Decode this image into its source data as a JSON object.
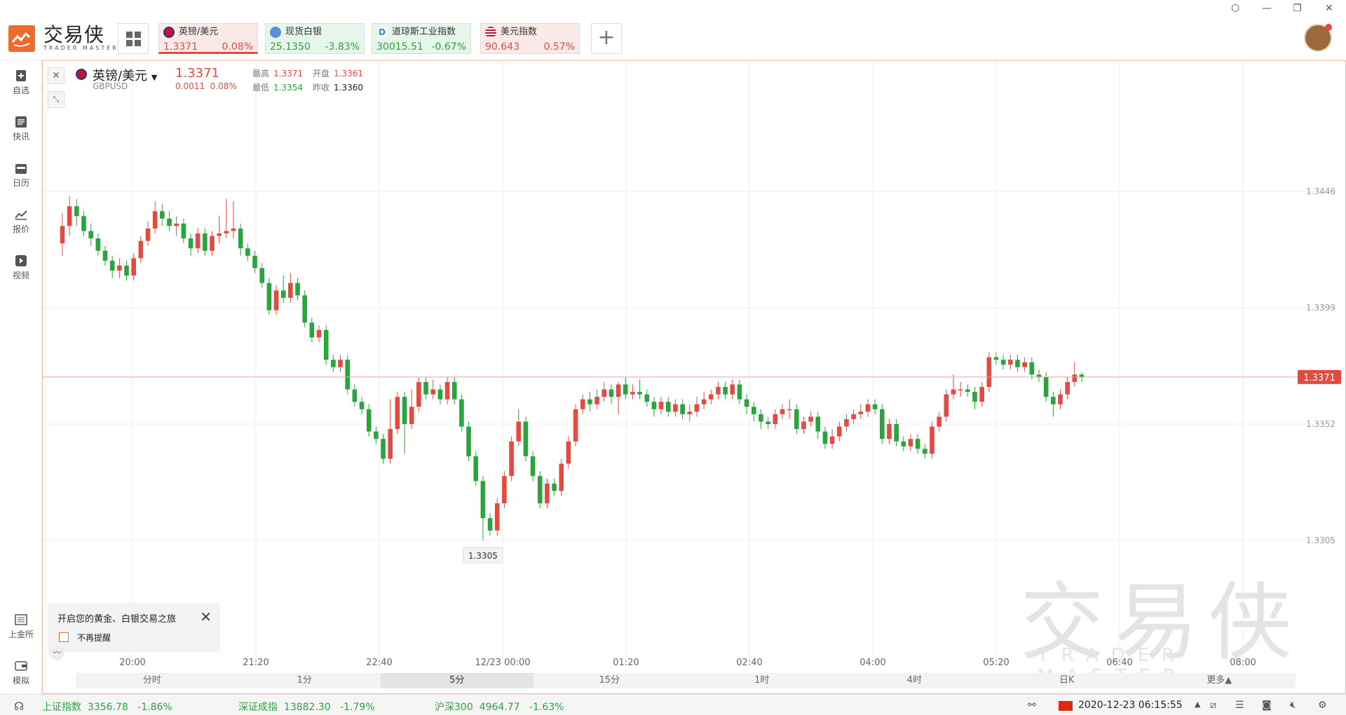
{
  "app": {
    "brand_cn": "交易侠",
    "brand_en": "TRADER MASTER"
  },
  "quote_tabs": [
    {
      "name": "英镑/美元",
      "price": "1.3371",
      "change": "0.08%",
      "direction": "up"
    },
    {
      "name": "现货白银",
      "price": "25.1350",
      "change": "-3.83%",
      "direction": "down"
    },
    {
      "name": "道琼斯工业指数",
      "price": "30015.51",
      "change": "-0.67%",
      "direction": "down"
    },
    {
      "name": "美元指数",
      "price": "90.643",
      "change": "0.57%",
      "direction": "up"
    }
  ],
  "sidebar": [
    {
      "label": "自选",
      "icon": "plus-bookmark-icon"
    },
    {
      "label": "快讯",
      "icon": "news-icon"
    },
    {
      "label": "日历",
      "icon": "calendar-icon"
    },
    {
      "label": "报价",
      "icon": "trend-icon"
    },
    {
      "label": "视频",
      "icon": "play-icon"
    },
    {
      "label": "上金所",
      "icon": "exchange-icon"
    },
    {
      "label": "模拟",
      "icon": "wallet-icon"
    }
  ],
  "symbol": {
    "name": "英镑/美元",
    "code": "GBPUSD",
    "price": "1.3371",
    "change_abs": "0.0011",
    "change_pct": "0.08%",
    "high_label": "最高",
    "high": "1.3371",
    "open_label": "开盘",
    "open": "1.3361",
    "low_label": "最低",
    "low": "1.3354",
    "prev_label": "昨收",
    "prev": "1.3360"
  },
  "popup": {
    "title": "开启您的黄金、白银交易之旅",
    "checkbox_label": "不再提醒"
  },
  "timeframes": [
    "分时",
    "1分",
    "5分",
    "15分",
    "1时",
    "4时",
    "日K",
    "更多▲"
  ],
  "active_timeframe": "5分",
  "status": {
    "idx1_name": "上证指数",
    "idx1_val": "3356.78",
    "idx1_chg": "-1.86%",
    "idx2_name": "深证成指",
    "idx2_val": "13882.30",
    "idx2_chg": "-1.79%",
    "idx3_name": "沪深300",
    "idx3_val": "4964.77",
    "idx3_chg": "-1.63%",
    "datetime": "2020-12-23 06:15:55"
  },
  "chart_data": {
    "type": "candlestick",
    "y_ticks": [
      "1.3446",
      "1.3399",
      "1.3352",
      "1.3305"
    ],
    "ylim": [
      1.3258,
      1.3493
    ],
    "x_ticks": [
      "20:00",
      "21:20",
      "22:40",
      "12/23 00:00",
      "01:20",
      "02:40",
      "04:00",
      "05:20",
      "06:40",
      "08:00"
    ],
    "current_price": "1.3371",
    "min_label": "1.3305",
    "colors": {
      "up": "#e24b3f",
      "down": "#2aa43c",
      "grid": "#ececec",
      "axis_text": "#999999"
    },
    "candles": [
      [
        1.3425,
        1.3432,
        1.342,
        1.3437
      ],
      [
        1.3432,
        1.344,
        1.3428,
        1.3444
      ],
      [
        1.344,
        1.3436,
        1.3432,
        1.3443
      ],
      [
        1.3436,
        1.343,
        1.3428,
        1.3438
      ],
      [
        1.343,
        1.3427,
        1.3424,
        1.3433
      ],
      [
        1.3427,
        1.3422,
        1.342,
        1.3429
      ],
      [
        1.3422,
        1.3418,
        1.3416,
        1.3424
      ],
      [
        1.3418,
        1.3414,
        1.3411,
        1.342
      ],
      [
        1.3414,
        1.3416,
        1.3411,
        1.3419
      ],
      [
        1.3416,
        1.3412,
        1.341,
        1.3418
      ],
      [
        1.3412,
        1.3419,
        1.341,
        1.3421
      ],
      [
        1.3419,
        1.3426,
        1.3417,
        1.3428
      ],
      [
        1.3426,
        1.3431,
        1.3424,
        1.3434
      ],
      [
        1.3431,
        1.3438,
        1.3429,
        1.3442
      ],
      [
        1.3438,
        1.3435,
        1.3432,
        1.3441
      ],
      [
        1.3435,
        1.3432,
        1.343,
        1.3438
      ],
      [
        1.3432,
        1.3433,
        1.3428,
        1.3436
      ],
      [
        1.3433,
        1.3427,
        1.3425,
        1.3435
      ],
      [
        1.3427,
        1.3423,
        1.342,
        1.3429
      ],
      [
        1.3423,
        1.3429,
        1.3421,
        1.3431
      ],
      [
        1.3429,
        1.3422,
        1.342,
        1.3431
      ],
      [
        1.3422,
        1.3428,
        1.342,
        1.343
      ],
      [
        1.3428,
        1.3429,
        1.3425,
        1.3436
      ],
      [
        1.3429,
        1.343,
        1.3427,
        1.3443
      ],
      [
        1.343,
        1.3431,
        1.3427,
        1.3442
      ],
      [
        1.3431,
        1.3423,
        1.342,
        1.3433
      ],
      [
        1.3423,
        1.342,
        1.3418,
        1.3425
      ],
      [
        1.342,
        1.3415,
        1.3413,
        1.3422
      ],
      [
        1.3415,
        1.3409,
        1.3407,
        1.3417
      ],
      [
        1.3409,
        1.3398,
        1.3396,
        1.3411
      ],
      [
        1.3398,
        1.3406,
        1.3396,
        1.3408
      ],
      [
        1.3406,
        1.3403,
        1.3401,
        1.3412
      ],
      [
        1.3403,
        1.3409,
        1.3401,
        1.3413
      ],
      [
        1.3409,
        1.3404,
        1.3402,
        1.3411
      ],
      [
        1.3404,
        1.3393,
        1.3391,
        1.3406
      ],
      [
        1.3393,
        1.3387,
        1.3385,
        1.3395
      ],
      [
        1.3387,
        1.339,
        1.3385,
        1.3392
      ],
      [
        1.339,
        1.3378,
        1.3376,
        1.3392
      ],
      [
        1.3378,
        1.3375,
        1.3373,
        1.338
      ],
      [
        1.3375,
        1.3378,
        1.3373,
        1.338
      ],
      [
        1.3378,
        1.3366,
        1.3364,
        1.338
      ],
      [
        1.3366,
        1.3361,
        1.3359,
        1.3368
      ],
      [
        1.3361,
        1.3358,
        1.3356,
        1.3363
      ],
      [
        1.3358,
        1.3349,
        1.3347,
        1.336
      ],
      [
        1.3349,
        1.3346,
        1.3344,
        1.3351
      ],
      [
        1.3346,
        1.3338,
        1.3336,
        1.3348
      ],
      [
        1.3338,
        1.335,
        1.3336,
        1.3362
      ],
      [
        1.335,
        1.3363,
        1.3348,
        1.3365
      ],
      [
        1.3363,
        1.3352,
        1.334,
        1.3365
      ],
      [
        1.3352,
        1.3359,
        1.335,
        1.3366
      ],
      [
        1.3359,
        1.3369,
        1.3357,
        1.3371
      ],
      [
        1.3369,
        1.3364,
        1.3362,
        1.3371
      ],
      [
        1.3364,
        1.3366,
        1.3362,
        1.337
      ],
      [
        1.3366,
        1.3362,
        1.336,
        1.3368
      ],
      [
        1.3362,
        1.3369,
        1.336,
        1.3371
      ],
      [
        1.3369,
        1.3362,
        1.336,
        1.3371
      ],
      [
        1.3362,
        1.3351,
        1.3349,
        1.3364
      ],
      [
        1.3351,
        1.3339,
        1.3337,
        1.3353
      ],
      [
        1.3339,
        1.3329,
        1.3327,
        1.3341
      ],
      [
        1.3329,
        1.3314,
        1.3305,
        1.3331
      ],
      [
        1.3314,
        1.3309,
        1.3307,
        1.3316
      ],
      [
        1.3309,
        1.332,
        1.3307,
        1.3322
      ],
      [
        1.332,
        1.3331,
        1.3318,
        1.3333
      ],
      [
        1.3331,
        1.3345,
        1.3329,
        1.3347
      ],
      [
        1.3345,
        1.3353,
        1.3343,
        1.3358
      ],
      [
        1.3353,
        1.3339,
        1.3337,
        1.3355
      ],
      [
        1.3339,
        1.3331,
        1.3329,
        1.3341
      ],
      [
        1.3331,
        1.332,
        1.3318,
        1.3333
      ],
      [
        1.332,
        1.3328,
        1.3318,
        1.333
      ],
      [
        1.3328,
        1.3325,
        1.3323,
        1.333
      ],
      [
        1.3325,
        1.3336,
        1.3323,
        1.3338
      ],
      [
        1.3336,
        1.3345,
        1.3334,
        1.3347
      ],
      [
        1.3345,
        1.3358,
        1.3343,
        1.336
      ],
      [
        1.3358,
        1.3362,
        1.3356,
        1.3364
      ],
      [
        1.3362,
        1.336,
        1.3357,
        1.3365
      ],
      [
        1.336,
        1.3363,
        1.3358,
        1.3366
      ],
      [
        1.3363,
        1.3366,
        1.3361,
        1.3369
      ],
      [
        1.3366,
        1.3363,
        1.336,
        1.3368
      ],
      [
        1.3363,
        1.3368,
        1.3356,
        1.3369
      ],
      [
        1.3368,
        1.3364,
        1.3362,
        1.3371
      ],
      [
        1.3364,
        1.3365,
        1.3362,
        1.3368
      ],
      [
        1.3365,
        1.3364,
        1.3362,
        1.337
      ],
      [
        1.3364,
        1.3361,
        1.3359,
        1.3366
      ],
      [
        1.3361,
        1.3358,
        1.3355,
        1.3363
      ],
      [
        1.3358,
        1.3361,
        1.3356,
        1.3363
      ],
      [
        1.3361,
        1.3357,
        1.3355,
        1.3363
      ],
      [
        1.3357,
        1.336,
        1.3355,
        1.3362
      ],
      [
        1.336,
        1.3356,
        1.3354,
        1.3362
      ],
      [
        1.3356,
        1.3357,
        1.3353,
        1.336
      ],
      [
        1.3357,
        1.336,
        1.3355,
        1.3363
      ],
      [
        1.336,
        1.3362,
        1.3358,
        1.3365
      ],
      [
        1.3362,
        1.3364,
        1.336,
        1.3366
      ],
      [
        1.3364,
        1.3367,
        1.3362,
        1.3369
      ],
      [
        1.3367,
        1.3364,
        1.3362,
        1.3369
      ],
      [
        1.3364,
        1.3368,
        1.3362,
        1.337
      ],
      [
        1.3368,
        1.3362,
        1.336,
        1.337
      ],
      [
        1.3362,
        1.3359,
        1.3356,
        1.3364
      ],
      [
        1.3359,
        1.3356,
        1.3353,
        1.3361
      ],
      [
        1.3356,
        1.3353,
        1.335,
        1.3358
      ],
      [
        1.3353,
        1.3352,
        1.335,
        1.3355
      ],
      [
        1.3352,
        1.3356,
        1.335,
        1.3358
      ],
      [
        1.3356,
        1.3358,
        1.3354,
        1.336
      ],
      [
        1.3358,
        1.3358,
        1.3354,
        1.3362
      ],
      [
        1.3358,
        1.335,
        1.3348,
        1.336
      ],
      [
        1.335,
        1.3353,
        1.3348,
        1.3355
      ],
      [
        1.3353,
        1.3355,
        1.3351,
        1.3357
      ],
      [
        1.3355,
        1.3349,
        1.3346,
        1.3357
      ],
      [
        1.3349,
        1.3344,
        1.3342,
        1.3351
      ],
      [
        1.3344,
        1.3347,
        1.3342,
        1.335
      ],
      [
        1.3347,
        1.3351,
        1.3345,
        1.3353
      ],
      [
        1.3351,
        1.3354,
        1.3349,
        1.3356
      ],
      [
        1.3354,
        1.3356,
        1.3352,
        1.3358
      ],
      [
        1.3356,
        1.3357,
        1.3354,
        1.336
      ],
      [
        1.3357,
        1.336,
        1.3355,
        1.3362
      ],
      [
        1.336,
        1.3358,
        1.3356,
        1.3362
      ],
      [
        1.3358,
        1.3346,
        1.3344,
        1.336
      ],
      [
        1.3346,
        1.3352,
        1.3344,
        1.3354
      ],
      [
        1.3352,
        1.3345,
        1.3343,
        1.3354
      ],
      [
        1.3345,
        1.3343,
        1.3341,
        1.3347
      ],
      [
        1.3343,
        1.3346,
        1.3341,
        1.3348
      ],
      [
        1.3346,
        1.3342,
        1.334,
        1.3348
      ],
      [
        1.3342,
        1.334,
        1.3338,
        1.3344
      ],
      [
        1.334,
        1.3351,
        1.3338,
        1.3353
      ],
      [
        1.3351,
        1.3355,
        1.3349,
        1.3357
      ],
      [
        1.3355,
        1.3364,
        1.3353,
        1.3366
      ],
      [
        1.3364,
        1.3366,
        1.3362,
        1.3372
      ],
      [
        1.3366,
        1.3366,
        1.3363,
        1.3369
      ],
      [
        1.3366,
        1.3365,
        1.3363,
        1.3368
      ],
      [
        1.3365,
        1.3361,
        1.3358,
        1.3367
      ],
      [
        1.3361,
        1.3367,
        1.3359,
        1.3369
      ],
      [
        1.3367,
        1.3379,
        1.3365,
        1.3381
      ],
      [
        1.3379,
        1.3378,
        1.3376,
        1.3381
      ],
      [
        1.3378,
        1.3376,
        1.3374,
        1.338
      ],
      [
        1.3376,
        1.3378,
        1.3374,
        1.338
      ],
      [
        1.3378,
        1.3375,
        1.3373,
        1.338
      ],
      [
        1.3375,
        1.3377,
        1.3373,
        1.3379
      ],
      [
        1.3377,
        1.3372,
        1.337,
        1.3379
      ],
      [
        1.3372,
        1.3371,
        1.3369,
        1.3374
      ],
      [
        1.3371,
        1.3363,
        1.3361,
        1.3373
      ],
      [
        1.3363,
        1.336,
        1.3355,
        1.3365
      ],
      [
        1.336,
        1.3364,
        1.3358,
        1.3366
      ],
      [
        1.3364,
        1.3369,
        1.3362,
        1.3371
      ],
      [
        1.3369,
        1.3372,
        1.3367,
        1.3377
      ],
      [
        1.3372,
        1.3371,
        1.3369,
        1.3373
      ]
    ]
  }
}
